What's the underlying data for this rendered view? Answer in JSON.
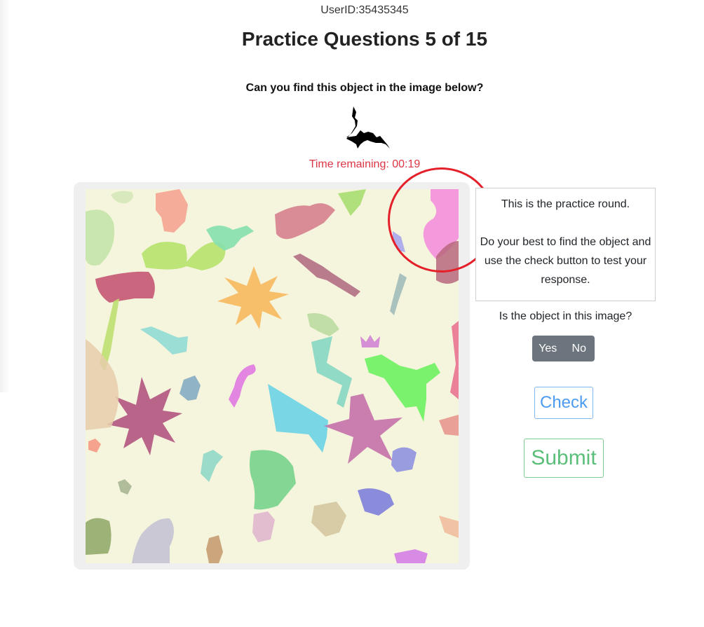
{
  "header": {
    "user_id": "UserID:35435345",
    "title": "Practice Questions 5 of 15"
  },
  "prompt": "Can you find this object in the image below?",
  "target_icon": "bat-silhouette-icon",
  "timer": {
    "label": "Time remaining:",
    "value": "00:19"
  },
  "info_box": {
    "line1": "This is the practice round.",
    "line2": "Do your best to find the object and use the check button to test your response."
  },
  "question": "Is the object in this image?",
  "buttons": {
    "yes": "Yes",
    "no": "No",
    "check": "Check",
    "submit": "Submit"
  },
  "colors": {
    "timer": "#dc3545",
    "search_background": "#f5f4dc",
    "annotation_circle": "#e4202a",
    "check_button": "#4d9cf0",
    "submit_button": "#5bbf7a",
    "yes_no_group": "#6c757d"
  }
}
